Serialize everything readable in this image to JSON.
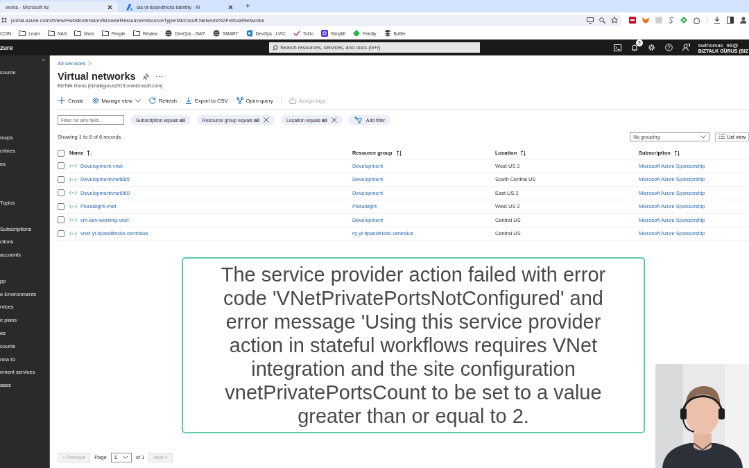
{
  "browser": {
    "tabs": [
      {
        "title": "works - Microsoft Az",
        "kind": "plain",
        "selected": true
      },
      {
        "title": "las-yt-tipandtricks-identity - M",
        "kind": "azure",
        "selected": false
      }
    ],
    "new_tab": "+",
    "url": "portal.azure.com/#view/HubsExtension/BrowseResource/resourceType/Microsoft.Network%2FvirtualNetworks",
    "bookmarks": [
      {
        "label": "COIN",
        "kind": "none"
      },
      {
        "label": "Learn",
        "kind": "folder"
      },
      {
        "label": "NAS",
        "kind": "folder"
      },
      {
        "label": "Mom",
        "kind": "folder"
      },
      {
        "label": "People",
        "kind": "folder"
      },
      {
        "label": "Review",
        "kind": "folder"
      },
      {
        "label": "DevOps - SWT",
        "kind": "globe"
      },
      {
        "label": "SMART",
        "kind": "globe"
      },
      {
        "label": "DevOps - LVIC",
        "kind": "devops"
      },
      {
        "label": "ToDo",
        "kind": "todo"
      },
      {
        "label": "Simplifi",
        "kind": "app"
      },
      {
        "label": "Feedly",
        "kind": "feedly"
      },
      {
        "label": "Buffer",
        "kind": "buffer"
      }
    ]
  },
  "portal_header": {
    "brand": "zure",
    "search_placeholder": "Search resources, services, and docs (G+/)",
    "notification_count": "3",
    "user": "swthomas_98@",
    "directory": "BIZTALK GURUS (BIZ"
  },
  "sidebar": {
    "collapse": "«",
    "items": [
      "source",
      "roups",
      "chines",
      "es",
      "Topics",
      "Subscriptions",
      "ctions",
      "accounts",
      "pp",
      "e Environments",
      "rvices",
      "e plans",
      "es",
      "counts",
      "ntra ID",
      "ement services",
      "ases"
    ]
  },
  "breadcrumb": "All services",
  "page": {
    "title": "Virtual networks",
    "subtitle": "BizTalk Gurus (biztalkgurus2013.onmicrosoft.com)"
  },
  "toolbar": [
    {
      "label": "Create",
      "kind": "add",
      "disabled": false
    },
    {
      "label": "Manage view",
      "kind": "settings",
      "disabled": false
    },
    {
      "label": "Refresh",
      "kind": "refresh",
      "disabled": false
    },
    {
      "label": "Export to CSV",
      "kind": "download",
      "disabled": false
    },
    {
      "label": "Open query",
      "kind": "query",
      "disabled": false
    },
    {
      "label": "Assign tags",
      "kind": "tag",
      "disabled": true
    }
  ],
  "filter": {
    "placeholder": "Filter for any field..."
  },
  "filter_pills": [
    {
      "label": "Subscription equals **all**",
      "kind": "filter",
      "removable": false
    },
    {
      "label": "Resource group equals **all**",
      "kind": "filter",
      "removable": true
    },
    {
      "label": "Location equals **all**",
      "kind": "filter",
      "removable": true
    },
    {
      "label": "Add filter",
      "kind": "add",
      "removable": false
    }
  ],
  "records_text": "Showing 1 to 6 of 6 records.",
  "grouping": "No grouping",
  "list_view": "List view",
  "table": {
    "all_selected": false,
    "columns": [
      {
        "label": "Name",
        "kind": "sorted"
      },
      {
        "label": "Resource group",
        "kind": "sortable"
      },
      {
        "label": "Location",
        "kind": "sortable"
      },
      {
        "label": "Subscription",
        "kind": "sortable"
      }
    ],
    "rows": [
      {
        "selected": false,
        "cells": [
          "Development-vnet",
          "Development",
          "West US 2",
          "Microsoft Azure Sponsorship"
        ]
      },
      {
        "selected": false,
        "cells": [
          "Developmentvnet885",
          "Development",
          "South Central US",
          "Microsoft Azure Sponsorship"
        ]
      },
      {
        "selected": false,
        "cells": [
          "Developmentvnet960",
          "Development",
          "East US 2",
          "Microsoft Azure Sponsorship"
        ]
      },
      {
        "selected": false,
        "cells": [
          "Pluralsight-vnet",
          "Pluralsight",
          "West US 2",
          "Microsoft Azure Sponsorship"
        ]
      },
      {
        "selected": false,
        "cells": [
          "vm-dev-working-vnet",
          "Development",
          "Central US",
          "Microsoft Azure Sponsorship"
        ]
      },
      {
        "selected": false,
        "cells": [
          "vnet-yt-tipandltricks-centralus",
          "rg-yt-tipandtricks-centralus",
          "Central US",
          "Microsoft Azure Sponsorship"
        ]
      }
    ]
  },
  "notice": "The service provider action failed with error code 'VNetPrivatePortsNotConfigured' and error message 'Using this service provider action in stateful workflows requires VNet integration and the site configuration vnetPrivatePortsCount to be set to a value greater than or equal to 2.",
  "pagination": {
    "previous": "< Previous",
    "previous_disabled": true,
    "page_label": "Page",
    "page": "1",
    "of": "of 1",
    "next": "Next >",
    "next_disabled": true
  }
}
